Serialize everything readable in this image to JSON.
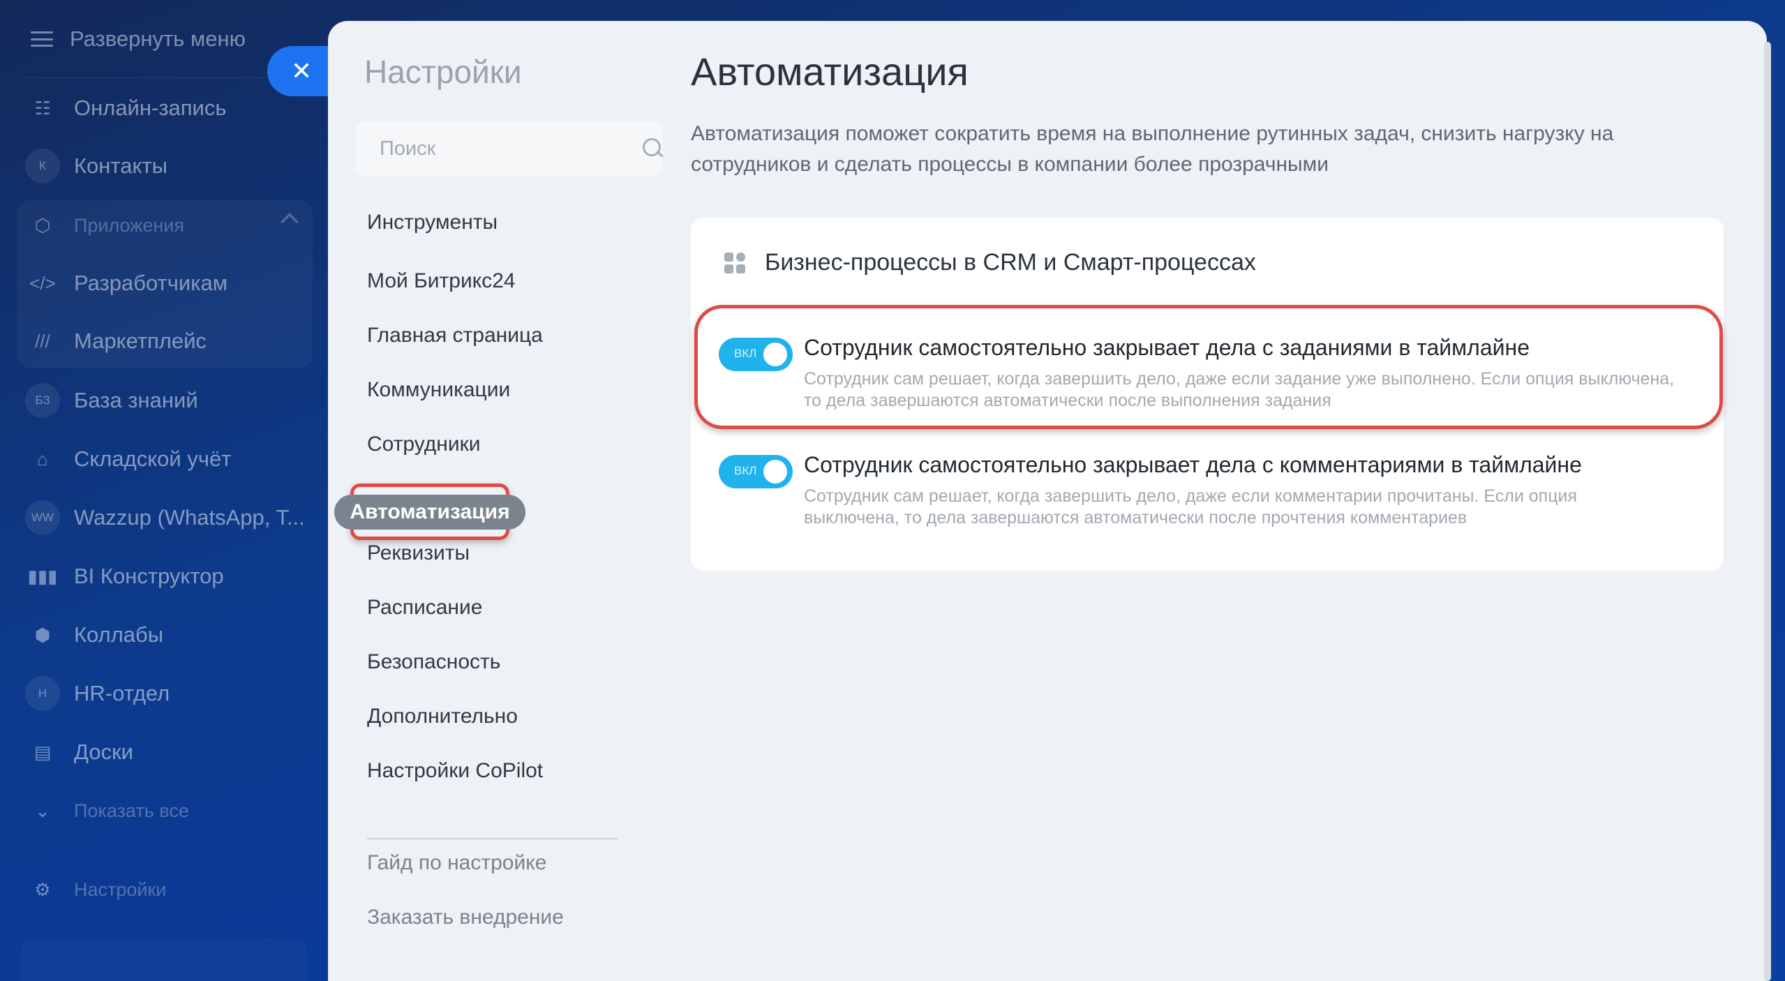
{
  "sidebar": {
    "expand_label": "Развернуть меню",
    "items": [
      {
        "label": "Онлайн-запись",
        "icon": "calendar-booking-icon"
      },
      {
        "label": "Контакты",
        "icon": "contacts-icon",
        "badge": "К"
      },
      {
        "label": "Приложения",
        "icon": "apps-cube-icon"
      },
      {
        "label": "Разработчикам",
        "icon": "code-icon"
      },
      {
        "label": "Маркетплейс",
        "icon": "marketplace-icon"
      },
      {
        "label": "База знаний",
        "icon": "knowledge-base-icon",
        "badge": "БЗ"
      },
      {
        "label": "Складской учёт",
        "icon": "warehouse-icon"
      },
      {
        "label": "Wazzup (WhatsApp, T...",
        "icon": "wazzup-icon",
        "badge": "WW"
      },
      {
        "label": "BI Конструктор",
        "icon": "bi-chart-icon"
      },
      {
        "label": "Коллабы",
        "icon": "collabs-icon"
      },
      {
        "label": "HR-отдел",
        "icon": "hr-icon",
        "badge": "H"
      },
      {
        "label": "Доски",
        "icon": "boards-icon"
      },
      {
        "label": "Показать все",
        "icon": "chevron-down-icon"
      },
      {
        "label": "Настройки",
        "icon": "gear-icon"
      }
    ]
  },
  "panel": {
    "title": "Настройки",
    "search_placeholder": "Поиск",
    "nav": [
      "Инструменты",
      "Мой Битрикс24",
      "Главная страница",
      "Коммуникации",
      "Сотрудники",
      "Автоматизация",
      "Реквизиты",
      "Расписание",
      "Безопасность",
      "Дополнительно",
      "Настройки CoPilot"
    ],
    "active_nav": "Автоматизация",
    "extra_links": [
      "Гайд по настройке",
      "Заказать внедрение"
    ]
  },
  "main": {
    "title": "Автоматизация",
    "description": "Автоматизация поможет сократить время на выполнение рутинных задач, снизить нагрузку на сотрудников и сделать процессы в компании более прозрачными",
    "card": {
      "title": "Бизнес-процессы в CRM и Смарт-процессах",
      "options": [
        {
          "toggle_label": "ВКЛ",
          "enabled": true,
          "title": "Сотрудник самостоятельно закрывает дела с заданиями в таймлайне",
          "description": "Сотрудник сам решает, когда завершить дело, даже если задание уже выполнено. Если опция выключена, то дела завершаются автоматически после выполнения задания"
        },
        {
          "toggle_label": "ВКЛ",
          "enabled": true,
          "title": "Сотрудник самостоятельно закрывает дела с комментариями в таймлайне",
          "description": "Сотрудник сам решает, когда завершить дело, даже если комментарии прочитаны. Если опция выключена, то дела завершаются автоматически после прочтения комментариев"
        }
      ]
    }
  },
  "colors": {
    "accent": "#1e74f0",
    "toggle_on": "#1fb2ec",
    "highlight": "#e04a44",
    "active_pill": "#7b848e"
  }
}
